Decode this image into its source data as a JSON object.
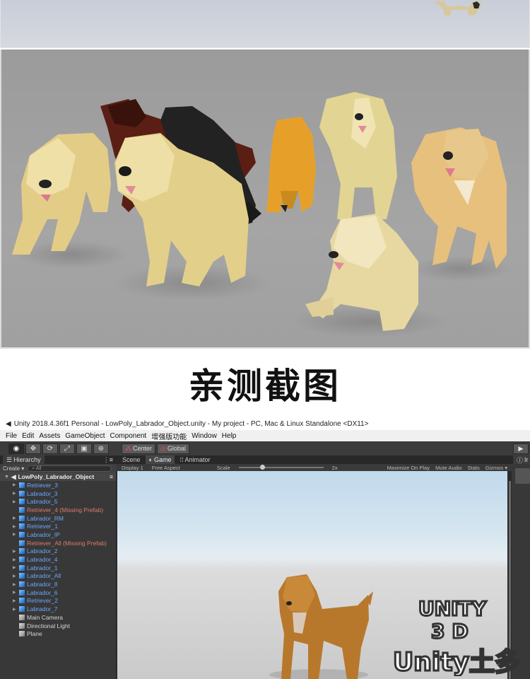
{
  "caption": "亲测截图",
  "titlebar": {
    "icon": "unity-logo-icon",
    "text": "Unity 2018.4.36f1 Personal - LowPoly_Labrador_Object.unity - My project - PC, Mac & Linux Standalone <DX11>"
  },
  "menu": [
    "File",
    "Edit",
    "Assets",
    "GameObject",
    "Component",
    "增强版功能",
    "Window",
    "Help"
  ],
  "toolbar": {
    "pivot_label": "Center",
    "space_label": "Global"
  },
  "hierarchy": {
    "tab_label": "Hierarchy",
    "create_label": "Create ▾",
    "search_placeholder": "All",
    "root": "LowPoly_Labrador_Object",
    "items": [
      {
        "label": "Retriever_3",
        "type": "prefab"
      },
      {
        "label": "Labrador_3",
        "type": "prefab"
      },
      {
        "label": "Labrador_5",
        "type": "prefab"
      },
      {
        "label": "Retriever_4 (Missing Prefab)",
        "type": "missing"
      },
      {
        "label": "Labrador_RM",
        "type": "prefab"
      },
      {
        "label": "Retriever_1",
        "type": "prefab"
      },
      {
        "label": "Labrador_IP",
        "type": "prefab"
      },
      {
        "label": "Retriever_All (Missing Prefab)",
        "type": "missing"
      },
      {
        "label": "Labrador_2",
        "type": "prefab"
      },
      {
        "label": "Labrador_4",
        "type": "prefab"
      },
      {
        "label": "Labrador_1",
        "type": "prefab"
      },
      {
        "label": "Labrador_All",
        "type": "prefab"
      },
      {
        "label": "Labrador_8",
        "type": "prefab"
      },
      {
        "label": "Labrador_6",
        "type": "prefab"
      },
      {
        "label": "Retriever_2",
        "type": "prefab"
      },
      {
        "label": "Labrador_7",
        "type": "prefab"
      },
      {
        "label": "Main Camera",
        "type": "object"
      },
      {
        "label": "Directional Light",
        "type": "object"
      },
      {
        "label": "Plane",
        "type": "object"
      }
    ]
  },
  "game_view": {
    "tabs": [
      "Scene",
      "Game",
      "Animator"
    ],
    "active_tab": "Game",
    "display": "Display 1",
    "aspect": "Free Aspect",
    "scale_label": "Scale",
    "scale_value": "2x",
    "options": [
      "Maximize On Play",
      "Mute Audio",
      "Stats",
      "Gizmos ▾"
    ]
  },
  "inspector": {
    "tab_label": "Ir"
  },
  "watermark": {
    "line1": "UNITY",
    "line2": "3D",
    "line3": "Unity土多"
  },
  "colors": {
    "prefab_text": "#6aa7ff",
    "missing_prefab_text": "#e07a6a",
    "editor_bg": "#383838"
  }
}
